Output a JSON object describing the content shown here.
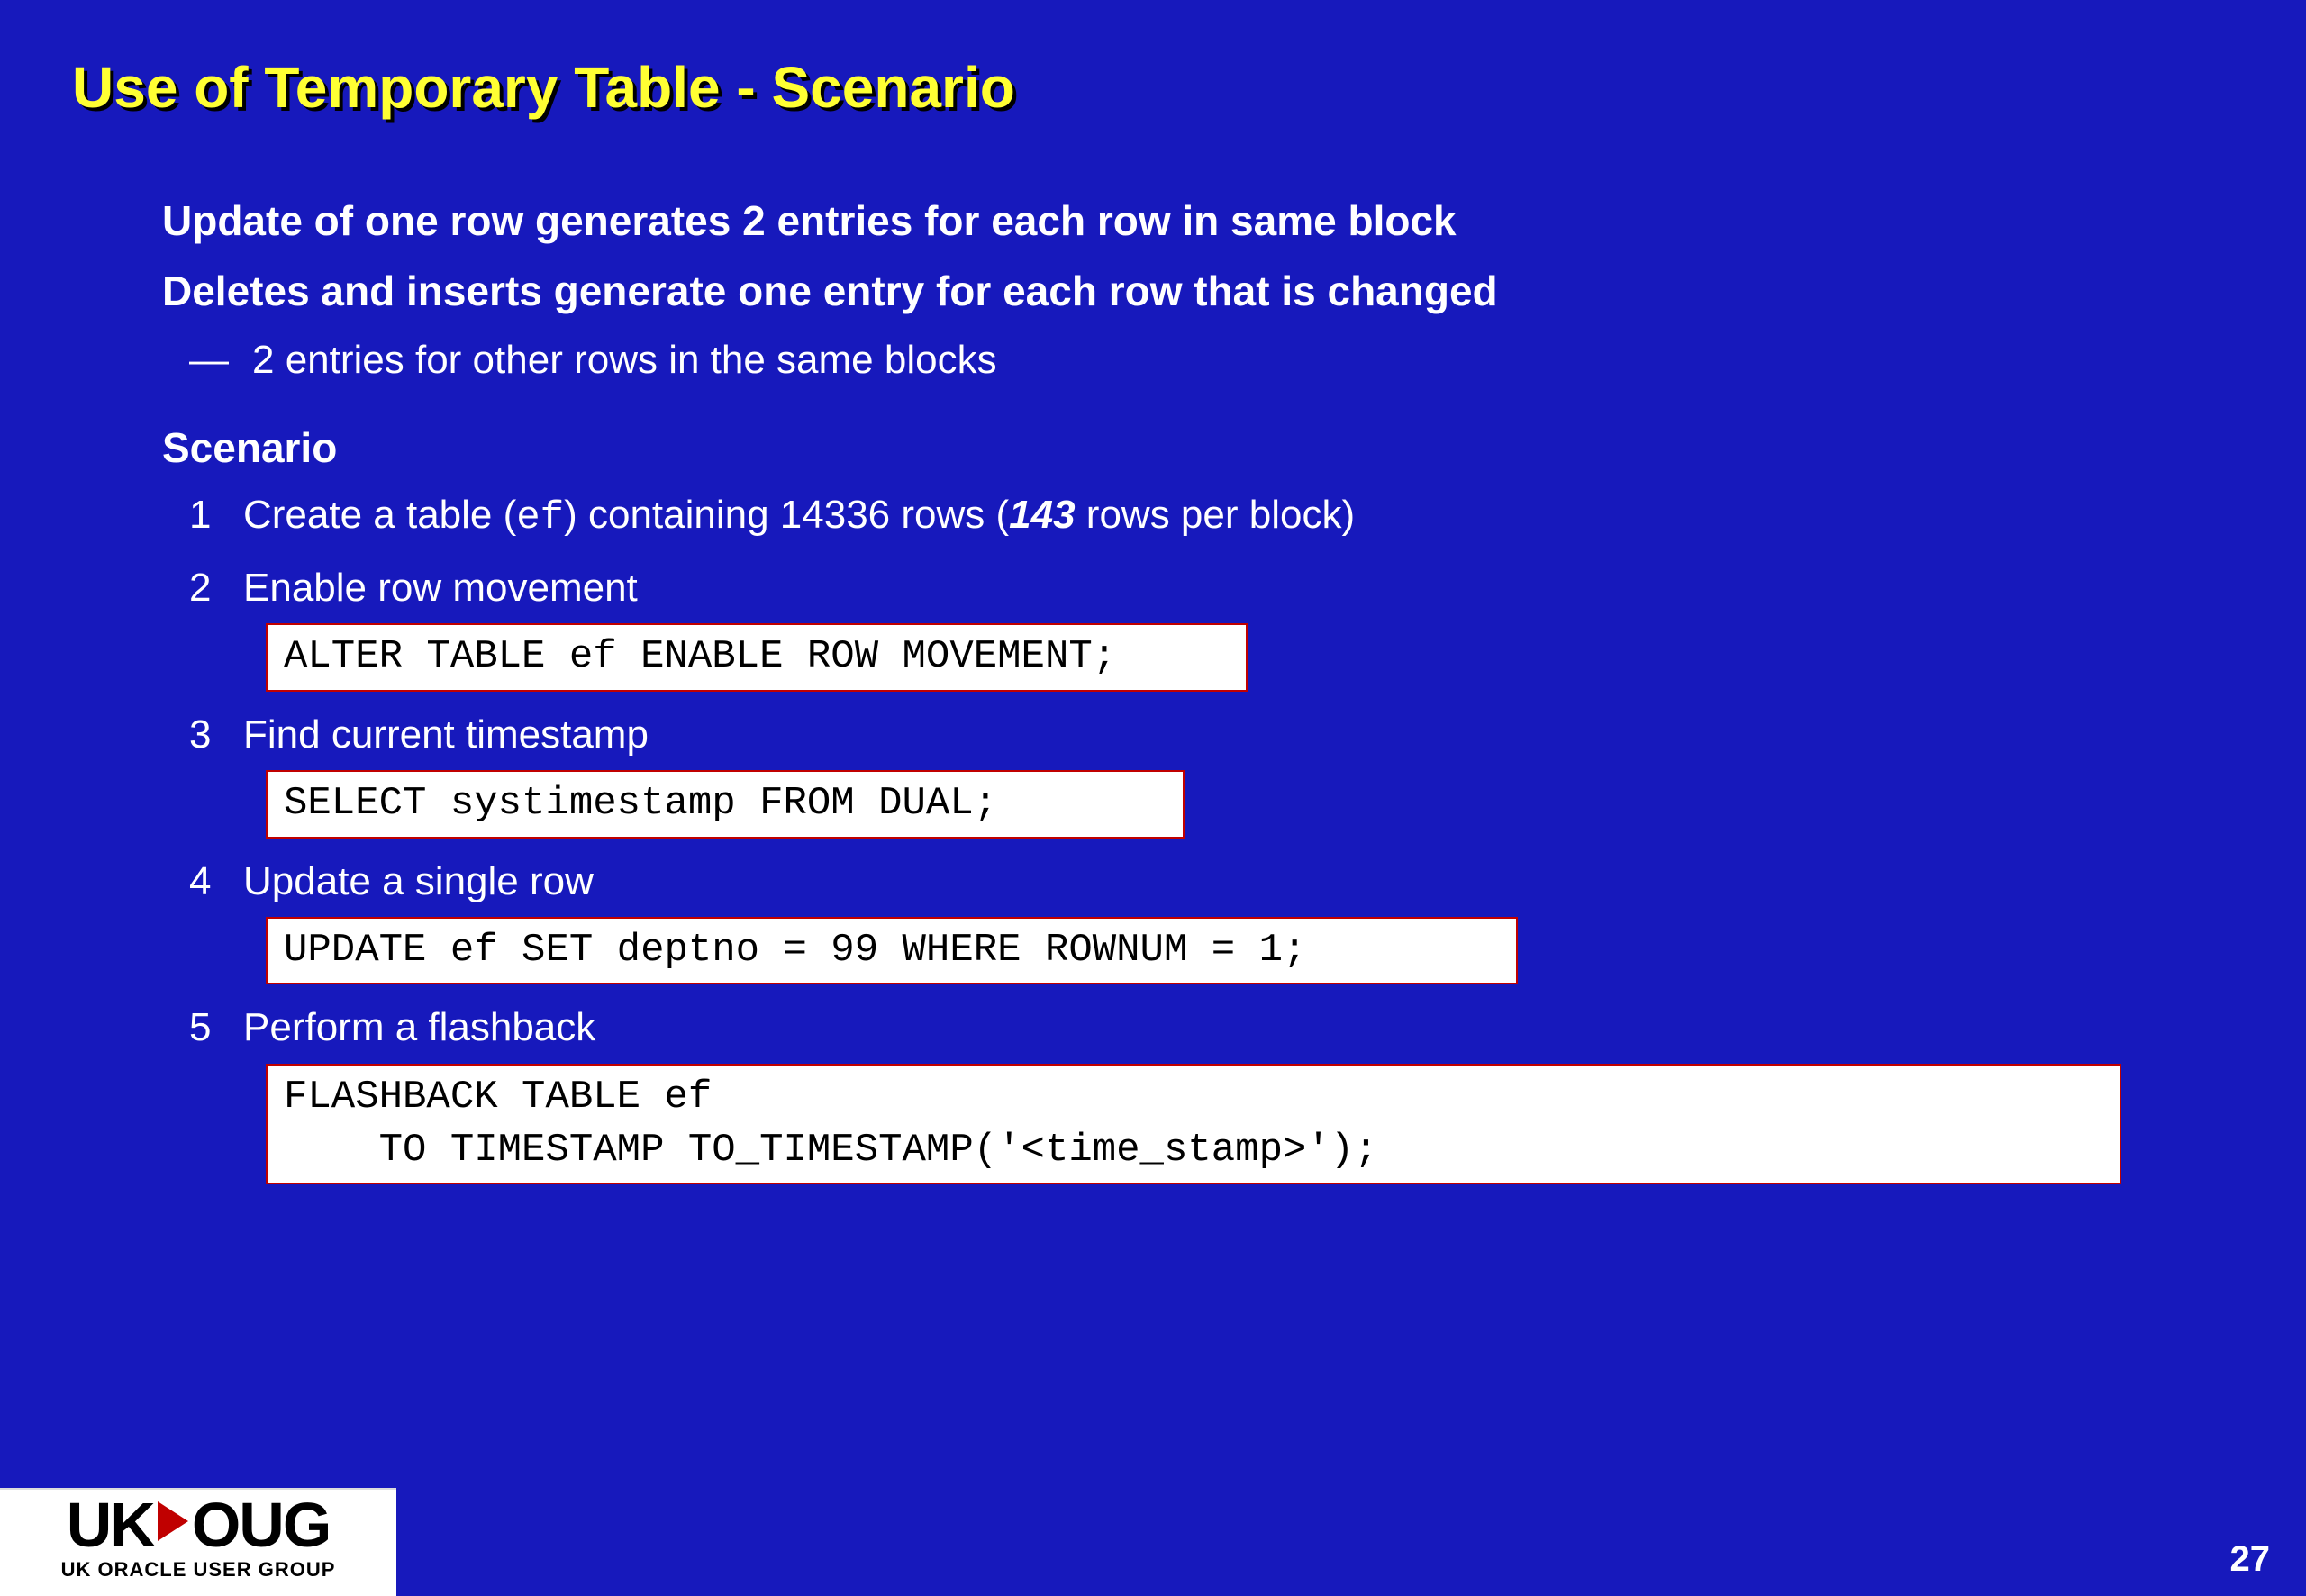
{
  "title": "Use of Temporary Table - Scenario",
  "bullets": {
    "b1": "Update of one row generates 2 entries for each row in same block",
    "b2": "Deletes and inserts generate one entry for each row that is changed",
    "b2_sub": "2 entries for other rows in the same blocks",
    "scenario_label": "Scenario"
  },
  "steps": {
    "s1_num": "1",
    "s1_pre": "Create a table (",
    "s1_code": "ef",
    "s1_mid": ") containing 14336 rows (",
    "s1_emph": "143",
    "s1_post": " rows per block)",
    "s2_num": "2",
    "s2_text": "Enable row movement",
    "s2_code": "ALTER TABLE ef ENABLE ROW MOVEMENT;",
    "s3_num": "3",
    "s3_text": "Find current timestamp",
    "s3_code": "SELECT systimestamp FROM DUAL;",
    "s4_num": "4",
    "s4_text": "Update a single row",
    "s4_code": "UPDATE ef SET deptno = 99 WHERE ROWNUM = 1;",
    "s5_num": "5",
    "s5_text": "Perform a flashback",
    "s5_code": "FLASHBACK TABLE ef\n    TO TIMESTAMP TO_TIMESTAMP('<time_stamp>');"
  },
  "logo": {
    "prefix": "UK",
    "suffix": "OUG",
    "sub": "UK ORACLE USER GROUP"
  },
  "page_number": "27"
}
